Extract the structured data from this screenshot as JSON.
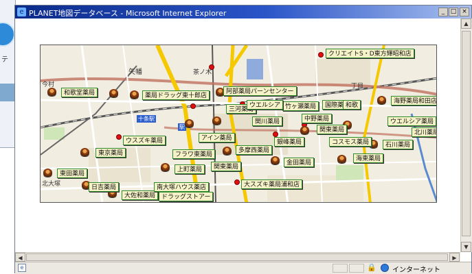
{
  "window": {
    "title": "PLANET地図データベース - Microsoft Internet Explorer",
    "buttons": {
      "minimize": "_",
      "maximize": "□",
      "close": "×"
    }
  },
  "status_bar": {
    "zone": "インターネット"
  },
  "map": {
    "place_names": [
      "矢幡",
      "茶ノ木",
      "今村",
      "丁目",
      "北大塚"
    ],
    "station_tags": [
      "十条駅",
      "駅"
    ],
    "labels": [
      "和歌堂薬局",
      "薬局ドラッグ東十郎店",
      "阿部薬局パーンセンター",
      "クリエイトS・D東方輝昭和店",
      "三河薬局",
      "竹ヶ瀬薬局",
      "ウエルシア",
      "国際薬局",
      "和歌",
      "関東薬局",
      "海野薬局和田店",
      "ウエルシア薬局",
      "ウスズキ薬局",
      "東京薬局",
      "石川薬局",
      "フラワ東薬局",
      "上町薬局",
      "多摩西薬局",
      "金田薬局",
      "海東薬局",
      "関東薬局",
      "東田薬局",
      "アイン薬局",
      "銀峰薬局",
      "コスモス薬局",
      "関川薬局",
      "北川薬局",
      "大スズキ薬局浦和店",
      "中野薬局",
      "日吉薬局",
      "大佐和薬局",
      "南大塚ハウス薬店",
      "ドラッグストアー"
    ]
  }
}
